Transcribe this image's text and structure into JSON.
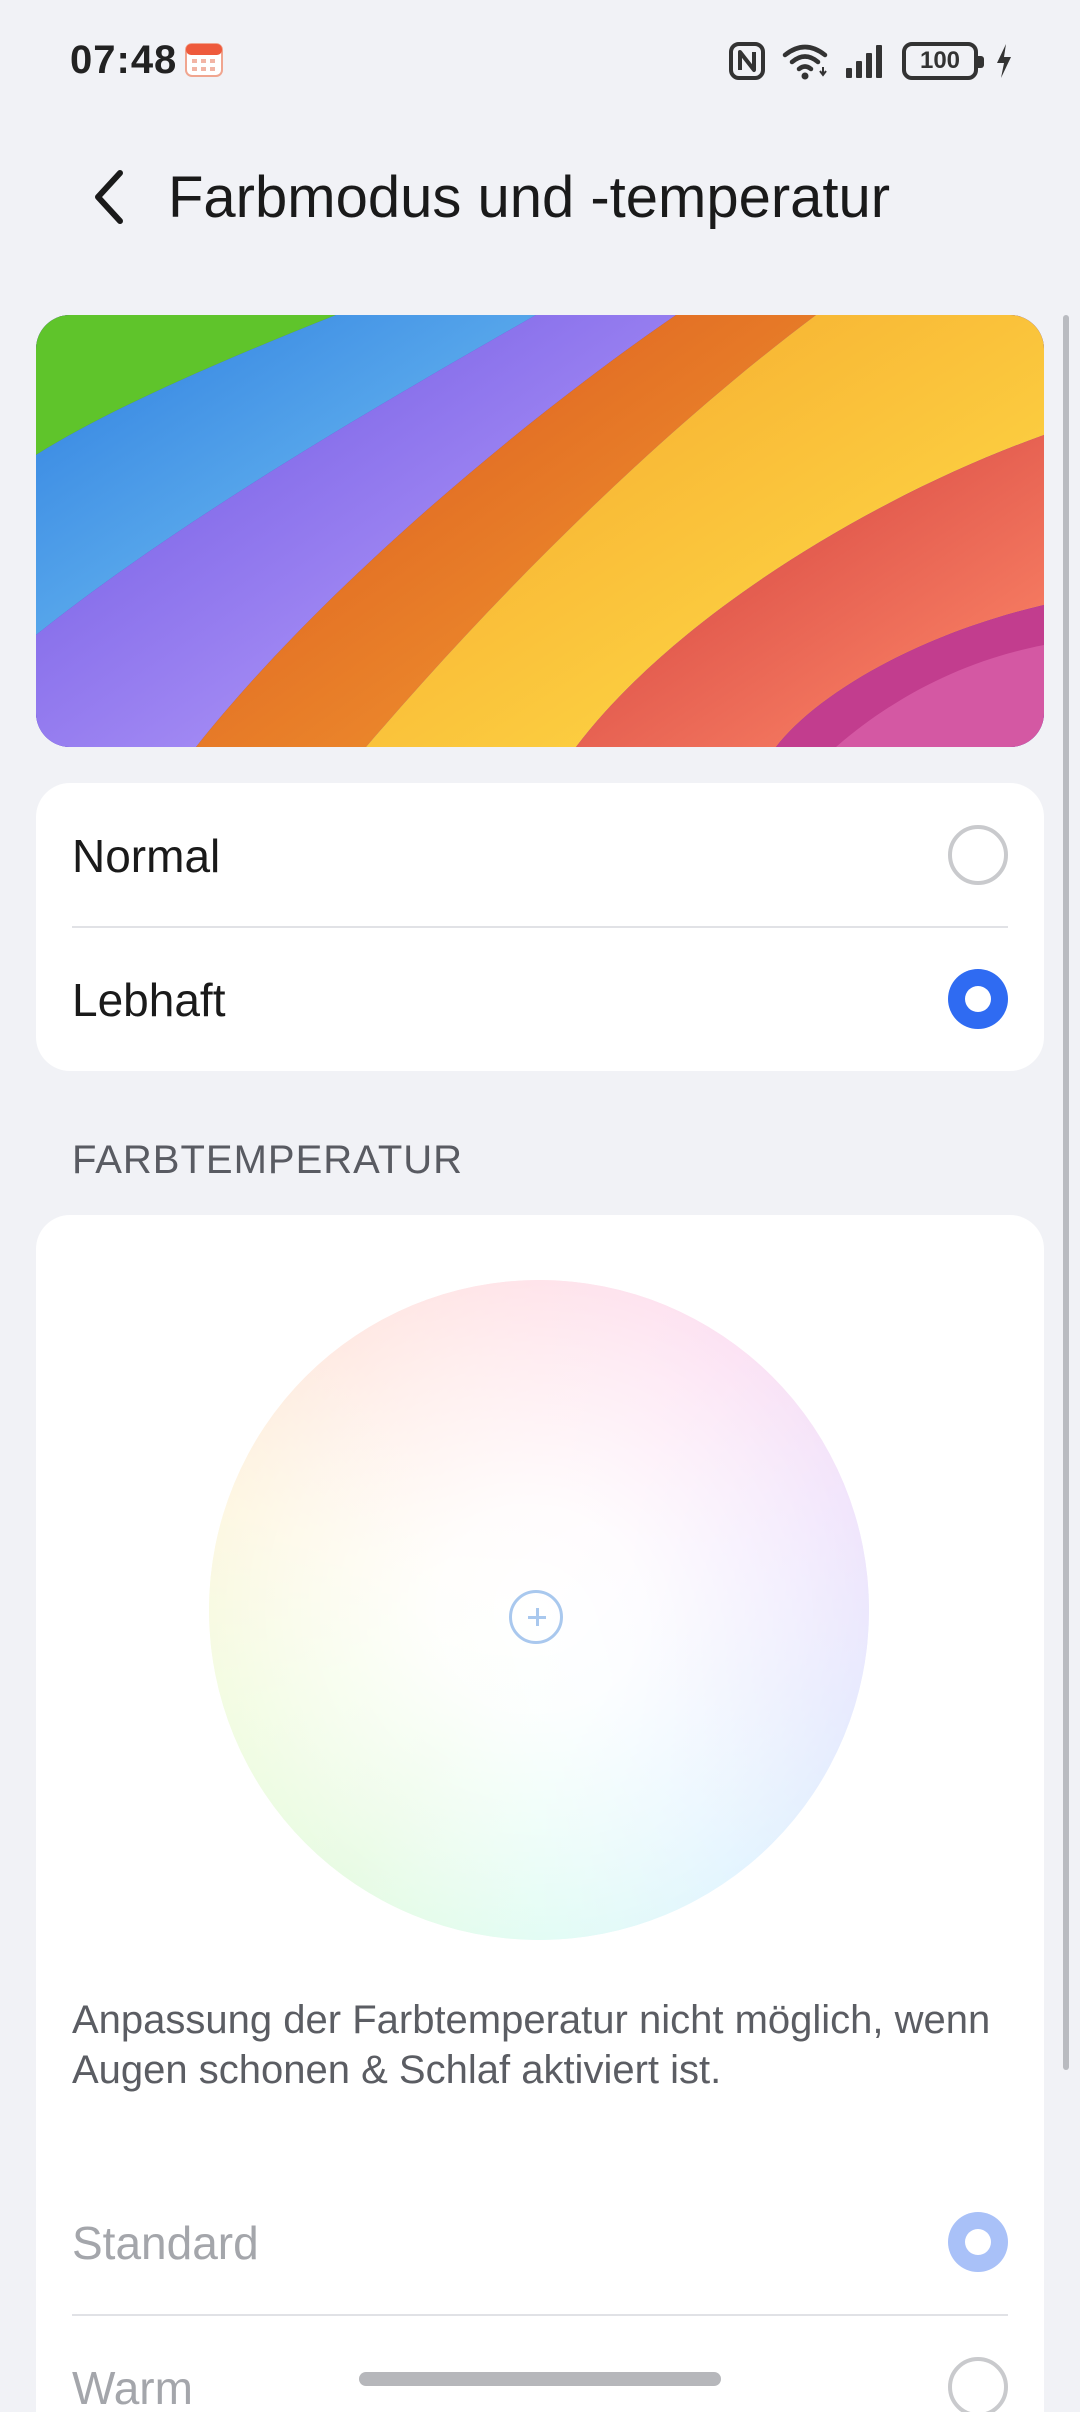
{
  "status_bar": {
    "time": "07:48",
    "battery": "100",
    "icons": [
      "calendar-icon",
      "nfc-icon",
      "wifi-icon",
      "signal-icon",
      "battery-icon",
      "charging-icon"
    ]
  },
  "header": {
    "title": "Farbmodus und -temperatur",
    "back_icon": "chevron-left-icon"
  },
  "color_mode": {
    "options": [
      {
        "label": "Normal",
        "selected": false
      },
      {
        "label": "Lebhaft",
        "selected": true
      }
    ]
  },
  "color_temperature": {
    "section_title": "FARBTEMPERATUR",
    "note": "Anpassung der Farbtemperatur nicht möglich, wenn Augen schonen & Schlaf aktiviert ist.",
    "options": [
      {
        "label": "Standard",
        "selected": true,
        "enabled": false
      },
      {
        "label": "Warm",
        "selected": false,
        "enabled": false
      }
    ]
  },
  "colors": {
    "accent": "#2f6bf2",
    "accent_disabled": "#a9c1f8",
    "background": "#f1f2f6",
    "card": "#ffffff"
  }
}
